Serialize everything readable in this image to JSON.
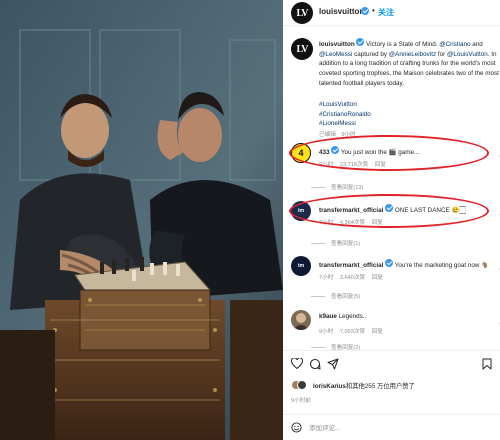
{
  "header": {
    "username": "louisvuitton",
    "follow_label": "关注",
    "dot": "•"
  },
  "caption": {
    "username": "louisvuitton",
    "text_1": " Victory is a State of Mind. ",
    "mention_1": "@Cristiano",
    "text_2": " and ",
    "mention_2": "@LeoMessi",
    "text_3": " captured by ",
    "mention_3": "@AnnieLeibovitz",
    "text_4": " for ",
    "mention_4": "@LouisVuitton",
    "text_5": ". In addition to a long tradition of crafting trunks for the world's most coveted sporting trophies, the Maison celebrates two of the most talented football players today.",
    "hashtags": [
      "#LouisVuitton",
      "#CristianoRonaldo",
      "#LionelMessi"
    ],
    "edited": "已编辑",
    "time": "9小时"
  },
  "comments": [
    {
      "username": "433",
      "text": "You just won the 🎬 game...",
      "time": "9小时",
      "likes": "23,718次赞",
      "reply": "回复",
      "view_replies": "查看回复(13)"
    },
    {
      "username": "transfermarkt_official",
      "text": "ONE LAST DANCE 😢🏻",
      "time": "7小时",
      "likes": "4,364次赞",
      "reply": "回复",
      "view_replies": "查看回复(1)"
    },
    {
      "username": "transfermarkt_official",
      "text": "You're the marketing goat now 🐐",
      "time": "7小时",
      "likes": "3,640次赞",
      "reply": "回复",
      "view_replies": "查看回复(5)"
    },
    {
      "username": "k9aue",
      "text": "Legends..",
      "time": "9小时",
      "likes": "7,003次赞",
      "reply": "回复",
      "view_replies": "查看回复(2)"
    }
  ],
  "likes": {
    "username": "lorisKarius",
    "text": "和其他255 万位用户赞了"
  },
  "post_time": "9小时前",
  "add_comment": {
    "placeholder": "添加评论..."
  },
  "colors": {
    "accent_blue": "#0095f6",
    "highlight_red": "#e2232a",
    "mention_blue": "#00376b"
  },
  "icons": [
    "lv-logo-icon",
    "verified-icon",
    "heart-icon",
    "comment-icon",
    "share-icon",
    "bookmark-icon",
    "emoji-icon"
  ]
}
